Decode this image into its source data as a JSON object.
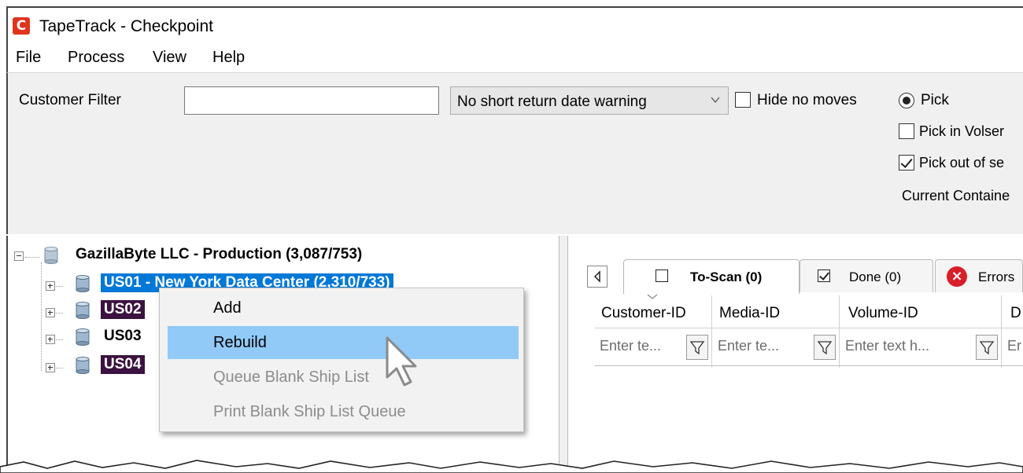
{
  "window": {
    "title": "TapeTrack - Checkpoint",
    "icon_letter": "C",
    "icon_color": "#e0341e"
  },
  "menu": [
    "File",
    "Process",
    "View",
    "Help"
  ],
  "toolbar": {
    "customer_filter_label": "Customer Filter",
    "customer_filter_value": "",
    "warning_select": "No short return date warning",
    "hide_no_moves_label": "Hide no moves",
    "hide_no_moves_checked": false,
    "pick_label": "Pick",
    "pick_selected": true,
    "pick_in_volser_label": "Pick in Volser",
    "pick_in_volser_checked": false,
    "pick_out_of_seq_label": "Pick out of se",
    "pick_out_of_seq_checked": true,
    "current_container_label": "Current Containe"
  },
  "tree": {
    "root_label": "GazillaByte LLC - Production (3,087/753)",
    "nodes": [
      {
        "label": "US01 - New York Data Center (2,310/733)",
        "style": "selected-blue"
      },
      {
        "label": "US02",
        "style": "selected-dark"
      },
      {
        "label": "US03",
        "style": "normal"
      },
      {
        "label": "US04",
        "style": "selected-dark"
      }
    ]
  },
  "context_menu": {
    "items": [
      {
        "label": "Add",
        "state": "normal"
      },
      {
        "label": "Rebuild",
        "state": "hover"
      },
      {
        "label": "Queue Blank Ship List",
        "state": "disabled"
      },
      {
        "label": "Print Blank Ship List Queue",
        "state": "disabled"
      }
    ]
  },
  "tabs": [
    {
      "label": "To-Scan (0)",
      "checked": false,
      "active": true
    },
    {
      "label": "Done (0)",
      "checked": true,
      "active": false
    },
    {
      "label": "Errors",
      "icon": "error-icon",
      "active": false
    }
  ],
  "grid": {
    "columns": [
      "Customer-ID",
      "Media-ID",
      "Volume-ID",
      "D"
    ],
    "filter_placeholders": [
      "Enter te...",
      "Enter te...",
      "Enter text h...",
      "Er"
    ]
  },
  "colors": {
    "selection": "#0078d7",
    "selection_dark": "#3b1240",
    "menu_hover": "#91c9f7",
    "error": "#d81e28"
  }
}
